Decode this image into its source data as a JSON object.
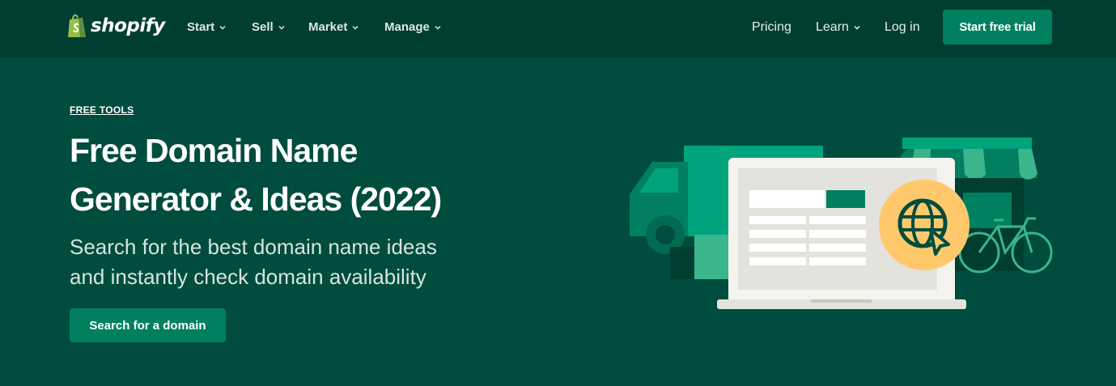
{
  "nav": {
    "logo_text": "shopify",
    "items": [
      {
        "label": "Start"
      },
      {
        "label": "Sell"
      },
      {
        "label": "Market"
      },
      {
        "label": "Manage"
      }
    ],
    "pricing": "Pricing",
    "learn": "Learn",
    "login": "Log in",
    "cta": "Start free trial"
  },
  "hero": {
    "eyebrow": "FREE TOOLS",
    "title_line1": "Free Domain Name",
    "title_line2": "Generator & Ideas (2022)",
    "subtitle_line1": "Search for the best domain name ideas",
    "subtitle_line2": "and instantly check domain availability",
    "cta": "Search for a domain"
  },
  "colors": {
    "nav_bg": "#003e32",
    "hero_bg": "#004c3f",
    "button": "#008060",
    "accent_yellow": "#ffc96b"
  },
  "icons": [
    "shopify-bag-icon",
    "chevron-down-icon",
    "globe-cursor-icon"
  ]
}
